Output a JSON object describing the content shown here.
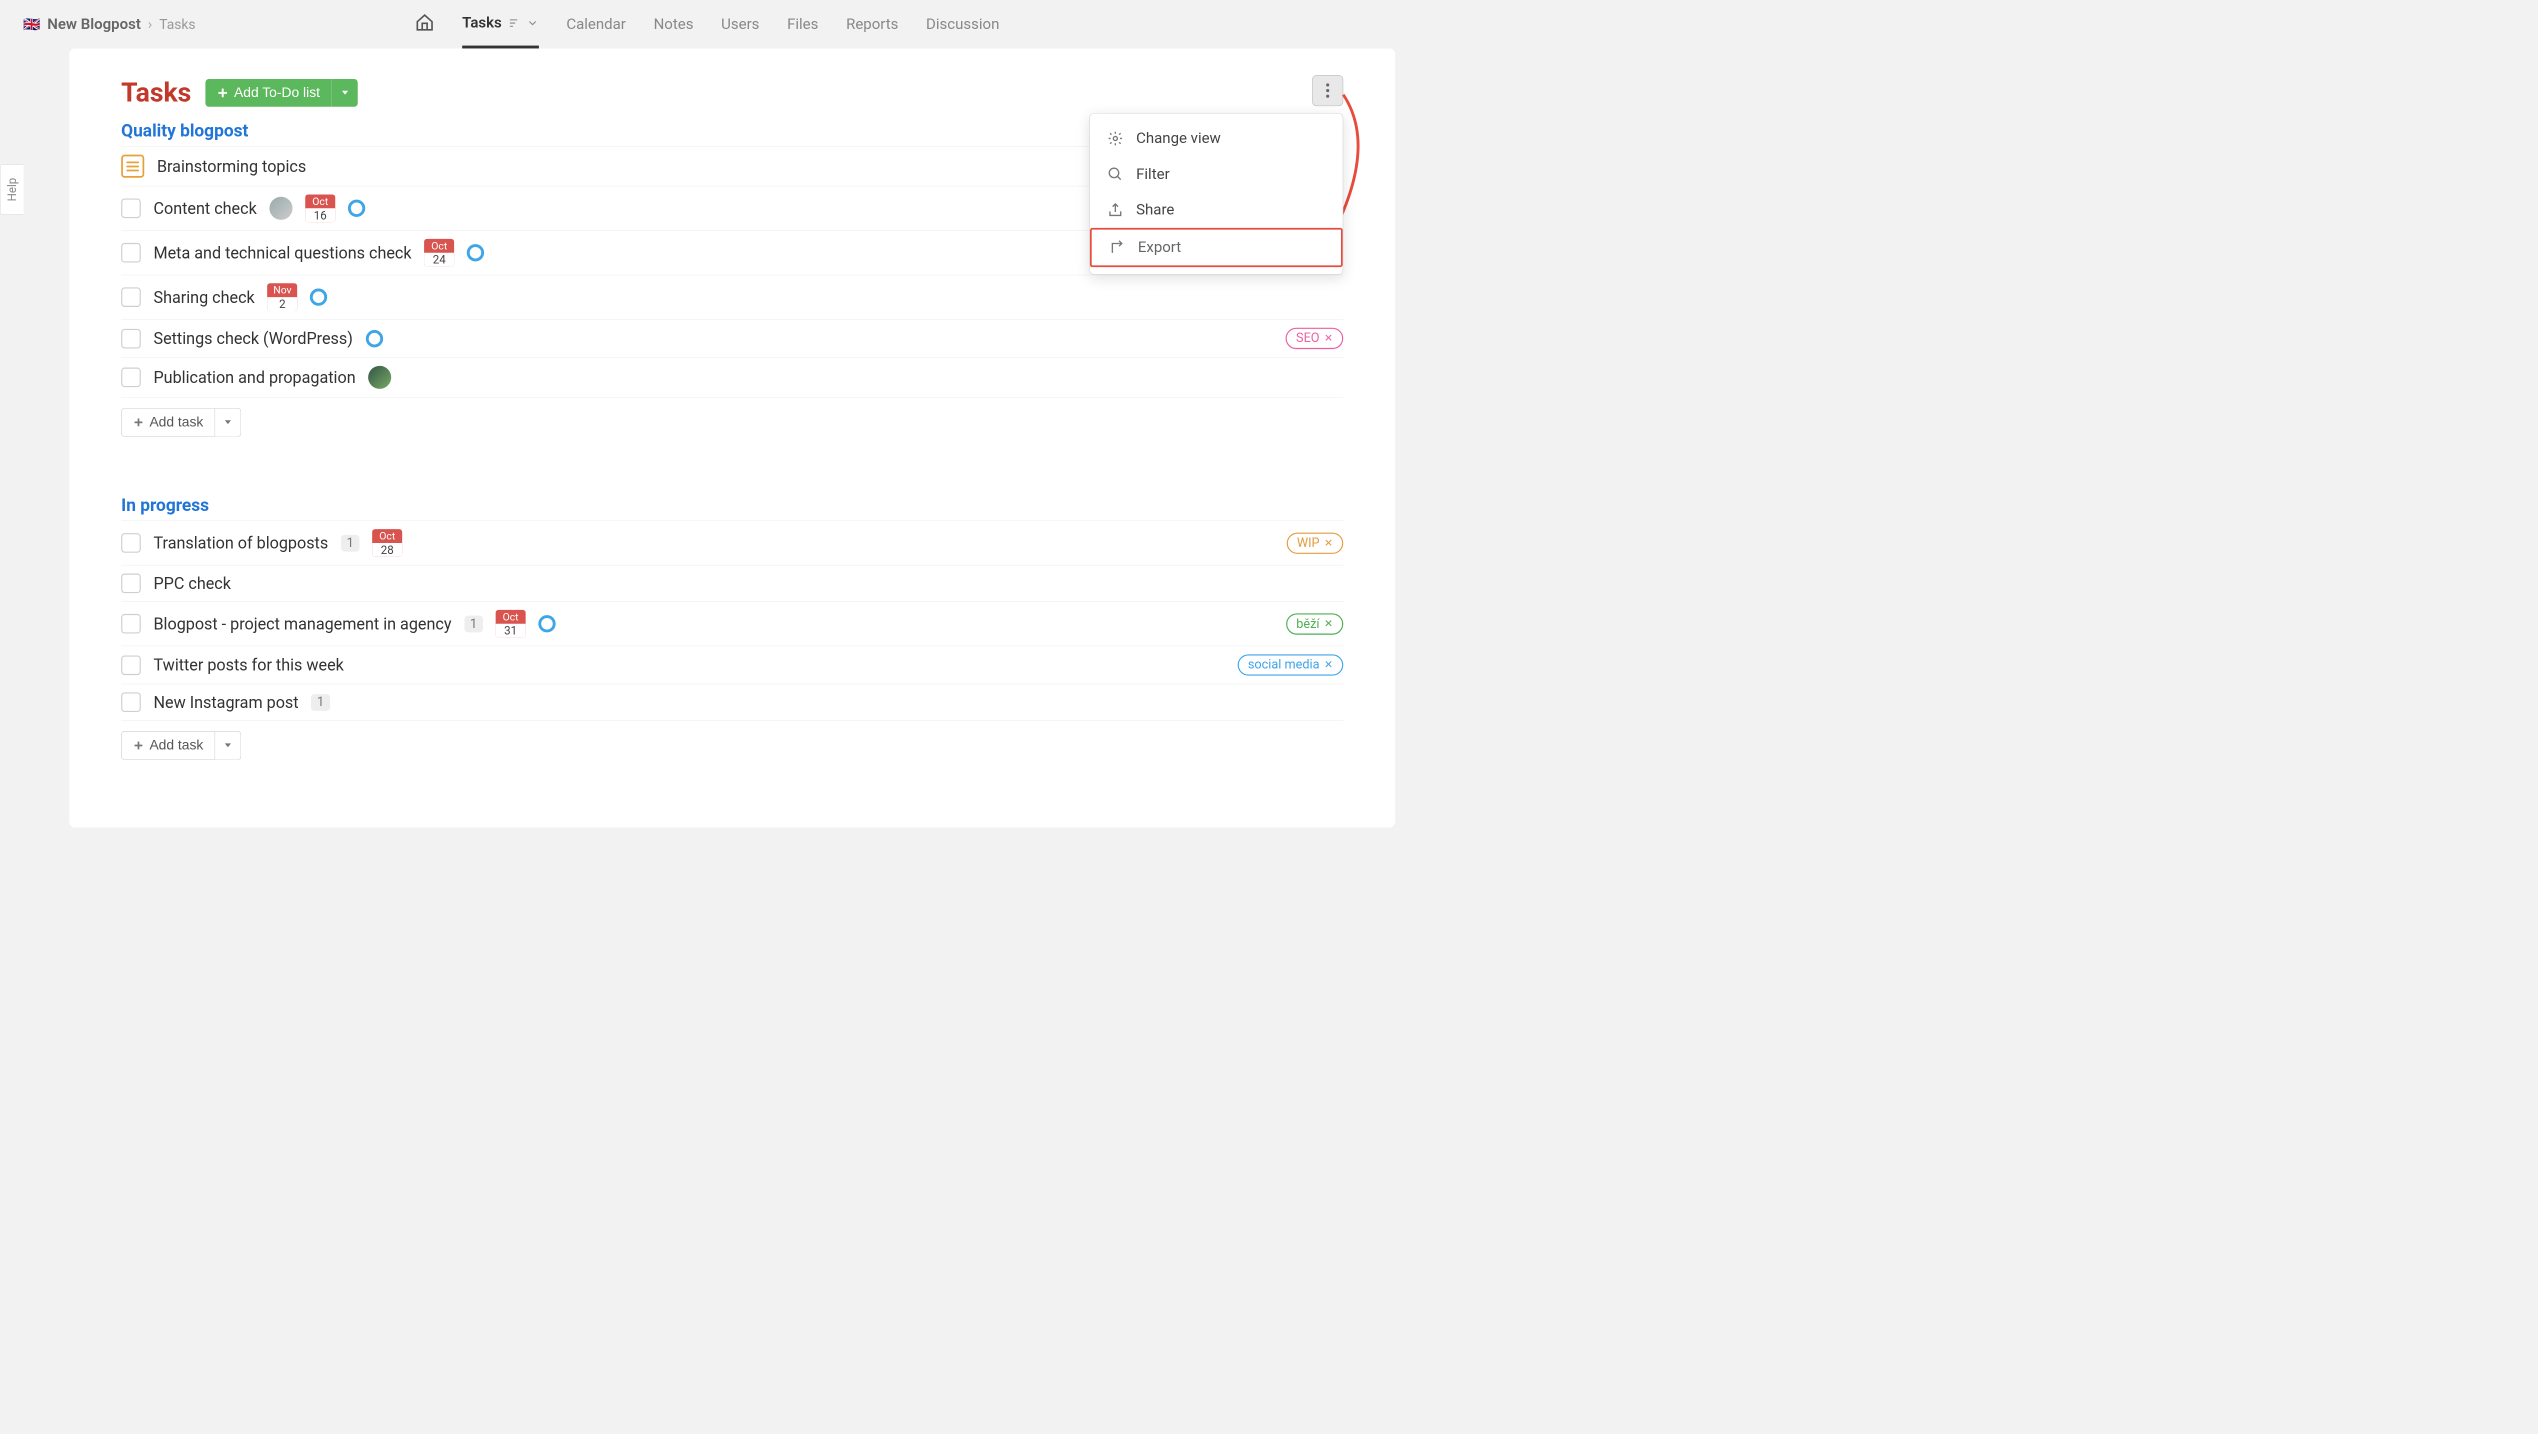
{
  "helpLabel": "Help",
  "breadcrumb": {
    "flag": "🇬🇧",
    "project": "New Blogpost",
    "leaf": "Tasks"
  },
  "navTabs": [
    "Tasks",
    "Calendar",
    "Notes",
    "Users",
    "Files",
    "Reports",
    "Discussion"
  ],
  "activeTab": "Tasks",
  "pageTitle": "Tasks",
  "addTodoLabel": "Add To-Do list",
  "addTaskLabel": "Add task",
  "dropdown": {
    "changeView": "Change view",
    "filter": "Filter",
    "share": "Share",
    "export": "Export"
  },
  "sections": [
    {
      "title": "Quality blogpost",
      "heading": "Brainstorming topics",
      "tasks": [
        {
          "title": "Content check",
          "avatar": true,
          "dateMonth": "Oct",
          "dateDay": "16",
          "ring": true
        },
        {
          "title": "Meta and technical questions check",
          "dateMonth": "Oct",
          "dateDay": "24",
          "ring": true
        },
        {
          "title": "Sharing check",
          "dateMonth": "Nov",
          "dateDay": "2",
          "ring": true
        },
        {
          "title": "Settings check (WordPress)",
          "ring": true,
          "tag": {
            "text": "SEO",
            "style": "pink"
          }
        },
        {
          "title": "Publication and propagation",
          "avatar2": true
        }
      ]
    },
    {
      "title": "In progress",
      "tasks": [
        {
          "title": "Translation of blogposts",
          "count": "1",
          "dateMonth": "Oct",
          "dateDay": "28",
          "tag": {
            "text": "WIP",
            "style": "orange"
          }
        },
        {
          "title": "PPC check"
        },
        {
          "title": "Blogpost - project management in agency",
          "count": "1",
          "dateMonth": "Oct",
          "dateDay": "31",
          "ring": true,
          "tag": {
            "text": "běží",
            "style": "green"
          }
        },
        {
          "title": "Twitter posts for this week",
          "tag": {
            "text": "social media",
            "style": "blue"
          }
        },
        {
          "title": "New Instagram post",
          "count": "1"
        }
      ]
    }
  ]
}
